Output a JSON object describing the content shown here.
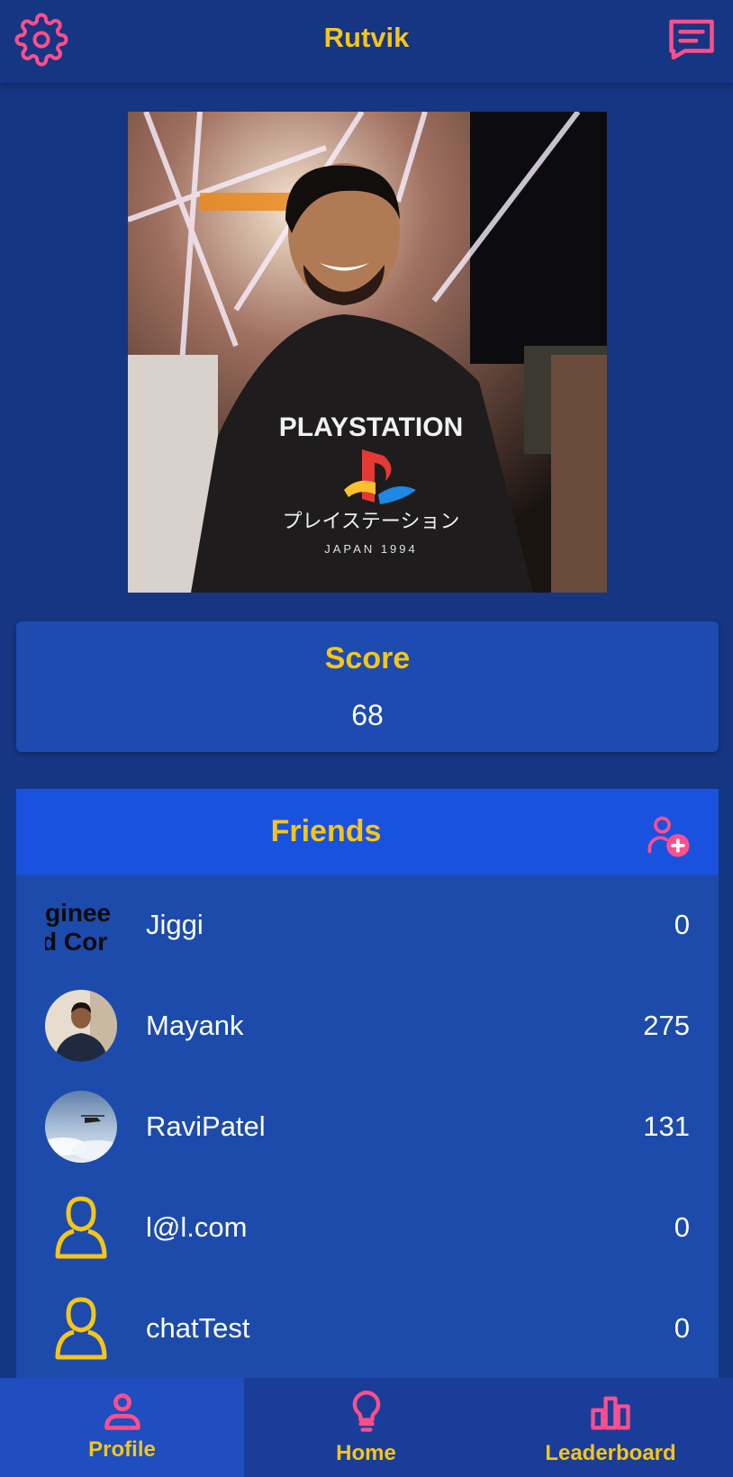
{
  "header": {
    "title": "Rutvik",
    "settings_icon": "gear-icon",
    "chat_icon": "chat-icon"
  },
  "profile_photo": {
    "hoodie_text": "PLAYSTATION",
    "hoodie_jp": "プレイステーション",
    "hoodie_sub": "JAPAN 1994"
  },
  "score": {
    "label": "Score",
    "value": "68"
  },
  "friends": {
    "title": "Friends",
    "add_icon": "add-friend-icon",
    "items": [
      {
        "name": "Jiggi",
        "score": "0",
        "avatar": "text-logo",
        "avatar_text_1": "ginee",
        "avatar_text_2": "d Cor"
      },
      {
        "name": "Mayank",
        "score": "275",
        "avatar": "photo-person"
      },
      {
        "name": "RaviPatel",
        "score": "131",
        "avatar": "photo-sky"
      },
      {
        "name": "l@l.com",
        "score": "0",
        "avatar": "default-user-icon"
      },
      {
        "name": "chatTest",
        "score": "0",
        "avatar": "default-user-icon"
      }
    ]
  },
  "nav": {
    "items": [
      {
        "label": "Profile",
        "icon": "person-icon",
        "active": true
      },
      {
        "label": "Home",
        "icon": "lightbulb-icon",
        "active": false
      },
      {
        "label": "Leaderboard",
        "icon": "bar-chart-icon",
        "active": false
      }
    ]
  },
  "colors": {
    "background": "#163582",
    "accent_yellow": "#f5c518",
    "accent_pink": "#ff4f8b",
    "friends_header": "#1a52e0"
  }
}
